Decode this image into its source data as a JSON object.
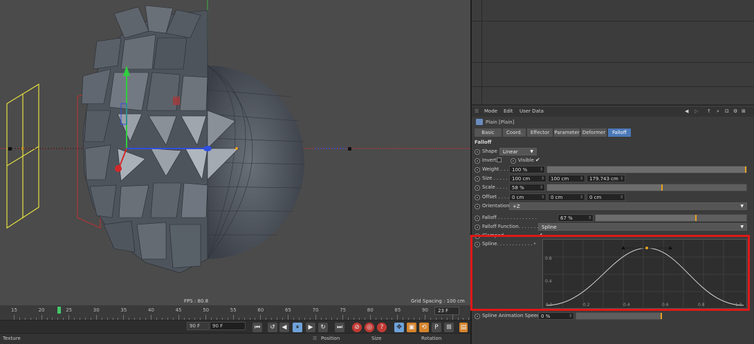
{
  "viewport": {
    "fps_label": "FPS : 80.8",
    "grid_spacing_label": "Grid Spacing : 100 cm"
  },
  "timeline": {
    "ruler_ticks": [
      "15",
      "20",
      "25",
      "30",
      "35",
      "40",
      "45",
      "50",
      "55",
      "60",
      "65",
      "70",
      "75",
      "80",
      "85",
      "90"
    ],
    "current_frame": "23 F",
    "start_frame_field": "0 F",
    "end_frame_field": "90 F",
    "end_frame_field_2": "90 F",
    "buttons": [
      "go-start",
      "prev-key",
      "prev-frame",
      "pause",
      "next-frame",
      "next-key",
      "go-end",
      "record",
      "autokey",
      "keyframe-selection",
      "move-key",
      "scale-key",
      "rotate-key",
      "param-key",
      "pla-key",
      "scheme"
    ]
  },
  "bottombar": {
    "texture_label": "Texture",
    "position_label": "Position",
    "size_label": "Size",
    "rotation_label": "Rotation"
  },
  "attributes": {
    "menu": {
      "mode": "Mode",
      "edit": "Edit",
      "user_data": "User Data"
    },
    "object_title": "Plain [Plain]",
    "tabs": [
      {
        "label": "Basic",
        "active": false
      },
      {
        "label": "Coord.",
        "active": false
      },
      {
        "label": "Effector",
        "active": false
      },
      {
        "label": "Parameter",
        "active": false
      },
      {
        "label": "Deformer",
        "active": false
      },
      {
        "label": "Falloff",
        "active": true
      }
    ],
    "section_title": "Falloff",
    "shape": {
      "label": "Shape",
      "value": "Linear"
    },
    "invert": {
      "label": "Invert",
      "checked": false
    },
    "visible": {
      "label": "Visible",
      "checked": true,
      "mark": "✔"
    },
    "weight": {
      "label": "Weight . . . .",
      "value": "100 %",
      "fraction": 1.0
    },
    "size": {
      "label": "Size . . . . . .",
      "x": "100 cm",
      "y": "100 cm",
      "z": "179.743 cm"
    },
    "scale": {
      "label": "Scale . . . . .",
      "value": "58 %",
      "fraction": 0.58
    },
    "offset": {
      "label": "Offset . . . .",
      "x": "0 cm",
      "y": "0 cm",
      "z": "0 cm"
    },
    "orientation": {
      "label": "Orientation",
      "value": "+Z"
    },
    "falloff": {
      "label": "Falloff . . . . . . . . . . . . .",
      "value": "67 %",
      "fraction": 0.67
    },
    "falloff_function": {
      "label": "Falloff Function. . . . . . .",
      "value": "Spline"
    },
    "clamped": {
      "label": "Clamped",
      "checked": true
    },
    "spline": {
      "label": "Spline. . . . . . . . . . . .",
      "y_ticks": [
        "0.8",
        "0.4"
      ],
      "x_ticks": [
        "0.0",
        "0.2",
        "0.4",
        "0.6",
        "0.8",
        "1.0"
      ]
    },
    "spline_speed": {
      "label": "Spline Animation Speed",
      "value": "0 %",
      "fraction": 0.0
    }
  }
}
